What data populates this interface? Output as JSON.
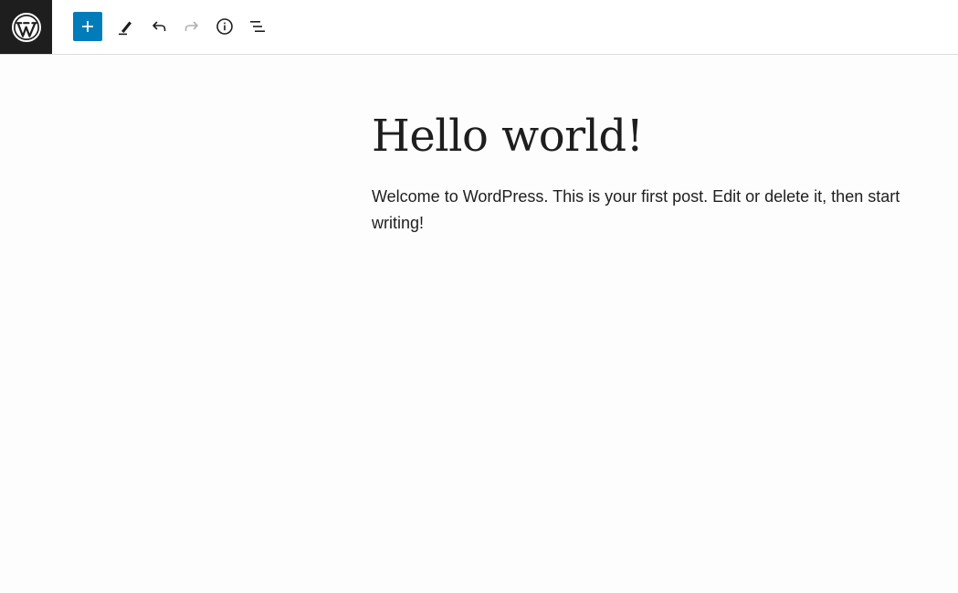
{
  "app": {
    "logo_icon": "wordpress-logo-icon"
  },
  "toolbar": {
    "add_block_icon": "plus-icon",
    "tools_icon": "pencil-icon",
    "undo_icon": "undo-icon",
    "redo_icon": "redo-icon",
    "details_icon": "info-icon",
    "list_view_icon": "list-view-icon",
    "accent_color": "#007cba"
  },
  "post": {
    "title": "Hello world!",
    "body": "Welcome to WordPress. This is your first post. Edit or delete it, then start writing!"
  }
}
